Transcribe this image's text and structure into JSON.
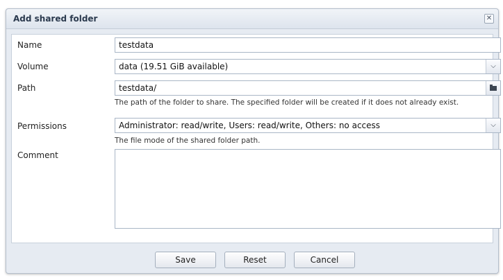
{
  "dialog": {
    "title": "Add shared folder",
    "close_glyph": "✕"
  },
  "form": {
    "name": {
      "label": "Name",
      "value": "testdata"
    },
    "volume": {
      "label": "Volume",
      "value": "data (19.51 GiB available)",
      "icon": "chevron-down-icon"
    },
    "path": {
      "label": "Path",
      "value": "testdata/",
      "icon": "folder-browse-icon",
      "help": "The path of the folder to share. The specified folder will be created if it does not already exist."
    },
    "permissions": {
      "label": "Permissions",
      "value": "Administrator: read/write, Users: read/write, Others: no access",
      "icon": "chevron-down-icon",
      "help": "The file mode of the shared folder path."
    },
    "comment": {
      "label": "Comment",
      "value": ""
    }
  },
  "buttons": {
    "save": "Save",
    "reset": "Reset",
    "cancel": "Cancel"
  }
}
